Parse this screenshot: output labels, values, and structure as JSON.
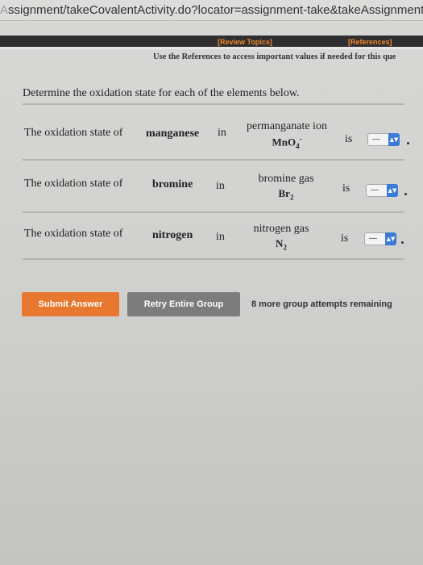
{
  "browser": {
    "url": "Assignment/takeCovalentActivity.do?locator=assignment-take&takeAssignmentS",
    "url_prefix_dim": "A",
    "url_rest": "ssignment/takeCovalentActivity.do?locator=assignment-take&takeAssignmentS"
  },
  "header": {
    "review_topics": "[Review Topics]",
    "references": "[References]",
    "instruction": "Use the References to access important values if needed for this que"
  },
  "question": {
    "prompt": "Determine the oxidation state for each of the elements below.",
    "rows": [
      {
        "lead": "The oxidation state of",
        "element": "manganese",
        "in": "in",
        "species_name": "permanganate ion",
        "formula": "MnO",
        "formula_sub": "4",
        "formula_sup": "-",
        "is": "is",
        "selected": "—"
      },
      {
        "lead": "The oxidation state of",
        "element": "bromine",
        "in": "in",
        "species_name": "bromine gas",
        "formula": "Br",
        "formula_sub": "2",
        "formula_sup": "",
        "is": "is",
        "selected": "—"
      },
      {
        "lead": "The oxidation state of",
        "element": "nitrogen",
        "in": "in",
        "species_name": "nitrogen gas",
        "formula": "N",
        "formula_sub": "2",
        "formula_sup": "",
        "is": "is",
        "selected": "—"
      }
    ]
  },
  "actions": {
    "submit_label": "Submit Answer",
    "retry_label": "Retry Entire Group",
    "attempts_text": "8 more group attempts remaining"
  },
  "colors": {
    "accent_orange": "#e8772f",
    "stepper_blue": "#3a7bd5",
    "retry_gray": "#7c7c7c"
  }
}
